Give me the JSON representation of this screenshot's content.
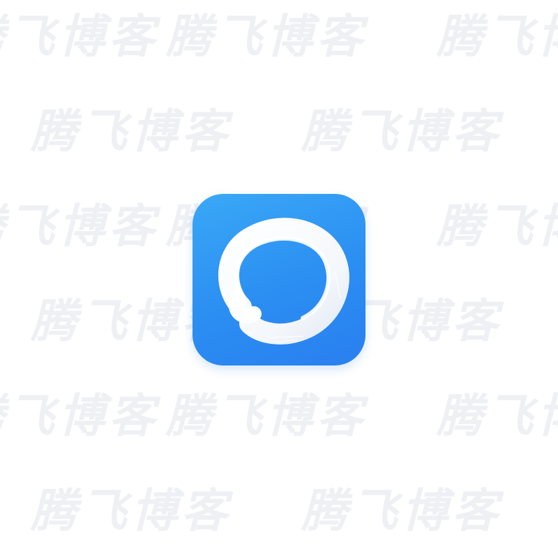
{
  "watermark": {
    "text": "腾飞博客",
    "color": "#eef0f4"
  },
  "app_icon": {
    "icon": "brush-stroke-circle-icon",
    "background_color": "#2b8ef2",
    "stroke_color": "#ffffff"
  }
}
